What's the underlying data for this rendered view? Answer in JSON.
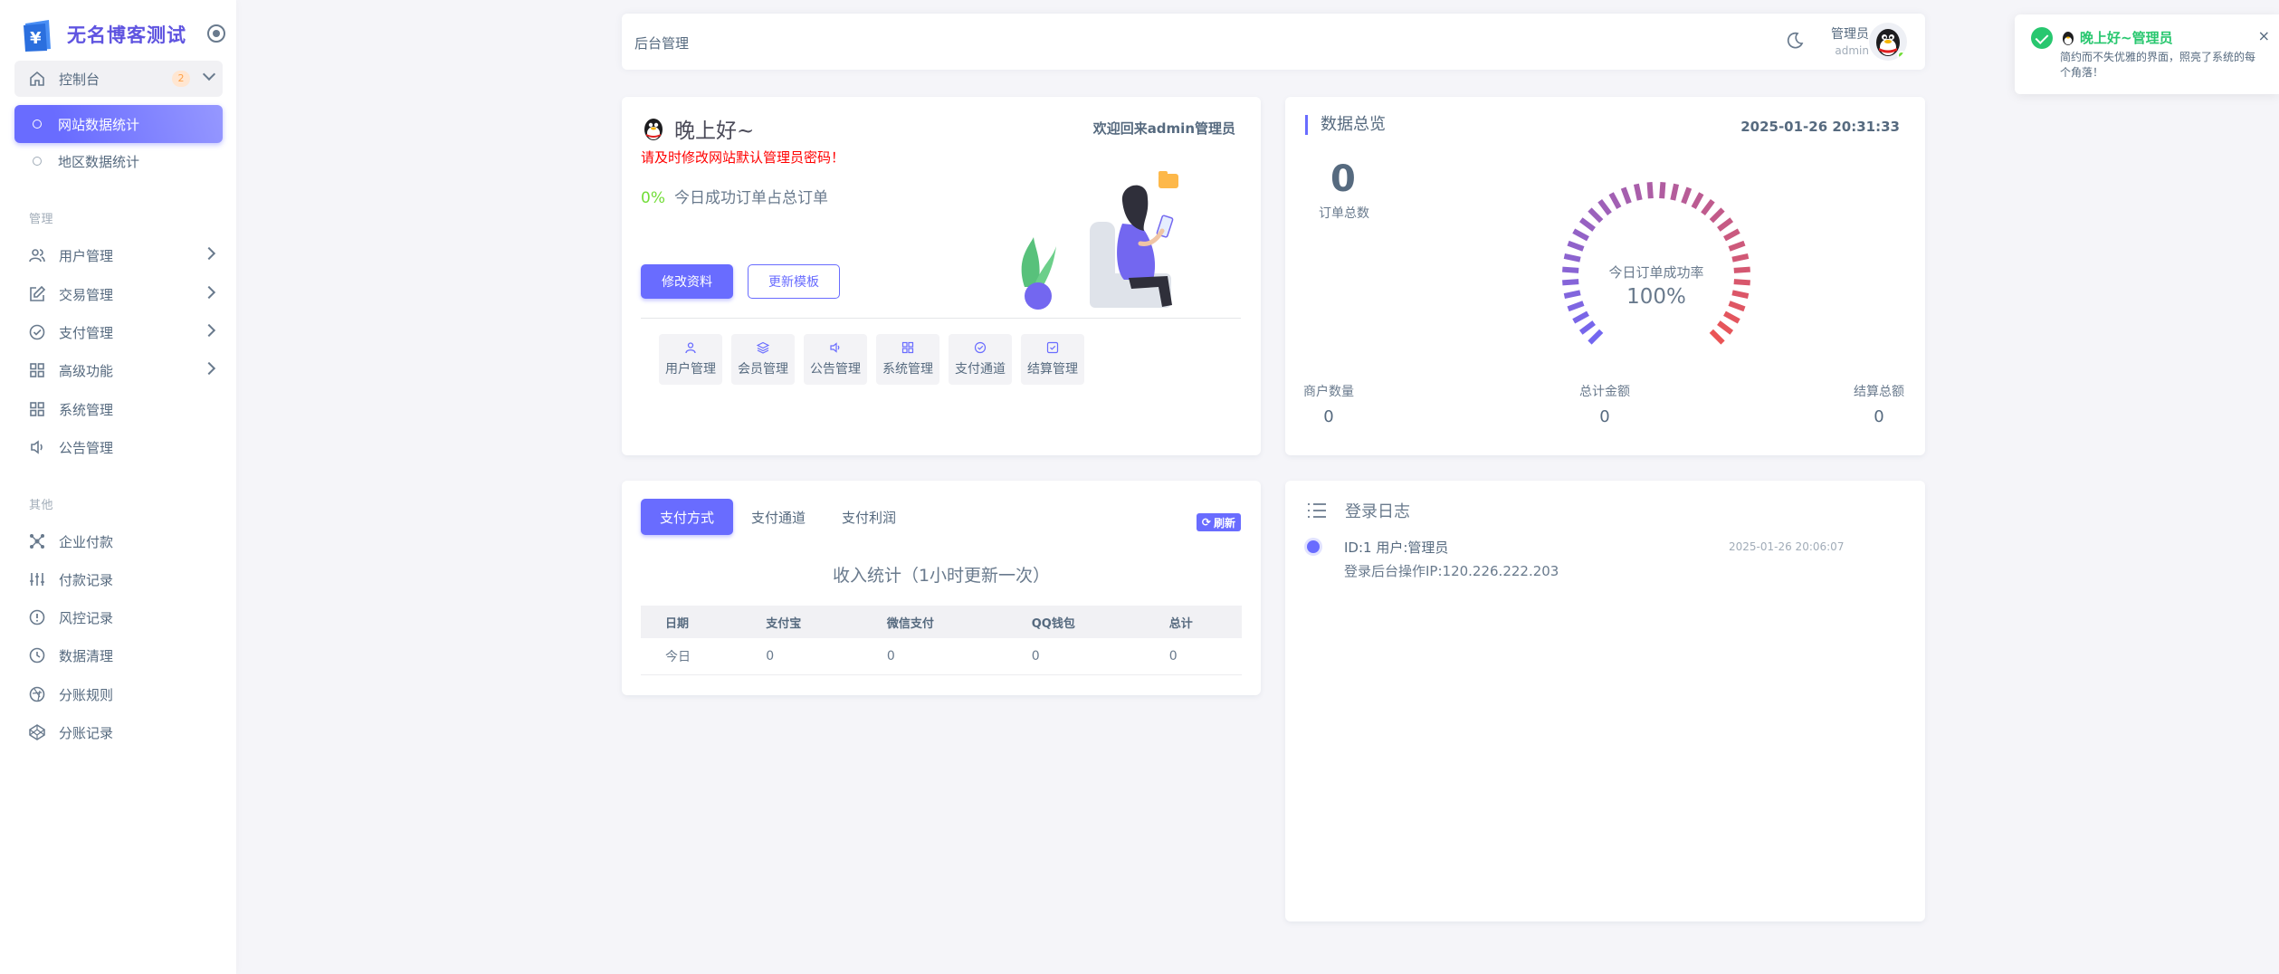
{
  "brand": {
    "name": "无名博客测试"
  },
  "sidebar": {
    "dashboard": {
      "label": "控制台",
      "badge": "2"
    },
    "sub_items": [
      "网站数据统计",
      "地区数据统计"
    ],
    "section_manage": "管理",
    "manage_items": [
      "用户管理",
      "交易管理",
      "支付管理",
      "高级功能",
      "系统管理",
      "公告管理"
    ],
    "section_other": "其他",
    "other_items": [
      "企业付款",
      "付款记录",
      "风控记录",
      "数据清理",
      "分账规则",
      "分账记录"
    ]
  },
  "navbar": {
    "title": "后台管理",
    "user_name": "管理员",
    "user_role": "admin"
  },
  "welcome": {
    "greeting": "晚上好~",
    "warning": "请及时修改网站默认管理员密码！",
    "rate_value": "0%",
    "rate_text": "今日成功订单占总订单",
    "welcome_back": "欢迎回来admin管理员",
    "btn_edit": "修改资料",
    "btn_template": "更新模板",
    "quick_links": [
      "用户管理",
      "会员管理",
      "公告管理",
      "系统管理",
      "支付通道",
      "结算管理"
    ]
  },
  "stats": {
    "title": "数据总览",
    "datetime": "2025-01-26 20:31:33",
    "orders_total": "0",
    "orders_label": "订单总数",
    "gauge_label": "今日订单成功率",
    "gauge_value": "100%",
    "mini": [
      {
        "label": "商户数量",
        "value": "0"
      },
      {
        "label": "总计金额",
        "value": "0"
      },
      {
        "label": "结算总额",
        "value": "0"
      }
    ]
  },
  "pay": {
    "tabs": [
      "支付方式",
      "支付通道",
      "支付利润"
    ],
    "refresh": "刷新",
    "title": "收入统计（1小时更新一次）",
    "columns": [
      "日期",
      "支付宝",
      "微信支付",
      "QQ钱包",
      "总计"
    ],
    "rows": [
      [
        "今日",
        "0",
        "0",
        "0",
        "0"
      ]
    ]
  },
  "log": {
    "title": "登录日志",
    "entry_line1": "ID:1 用户:管理员",
    "entry_line2": "登录后台操作IP:120.226.222.203",
    "entry_time": "2025-01-26 20:06:07"
  },
  "toast": {
    "title": "晚上好~管理员",
    "message": "简约而不失优雅的界面，照亮了系统的每个角落！",
    "close": "×"
  },
  "colors": {
    "primary": "#696cff",
    "success": "#28c76f",
    "danger": "#ff0000",
    "gauge_start": "#7367f0",
    "gauge_end": "#ea5455"
  }
}
